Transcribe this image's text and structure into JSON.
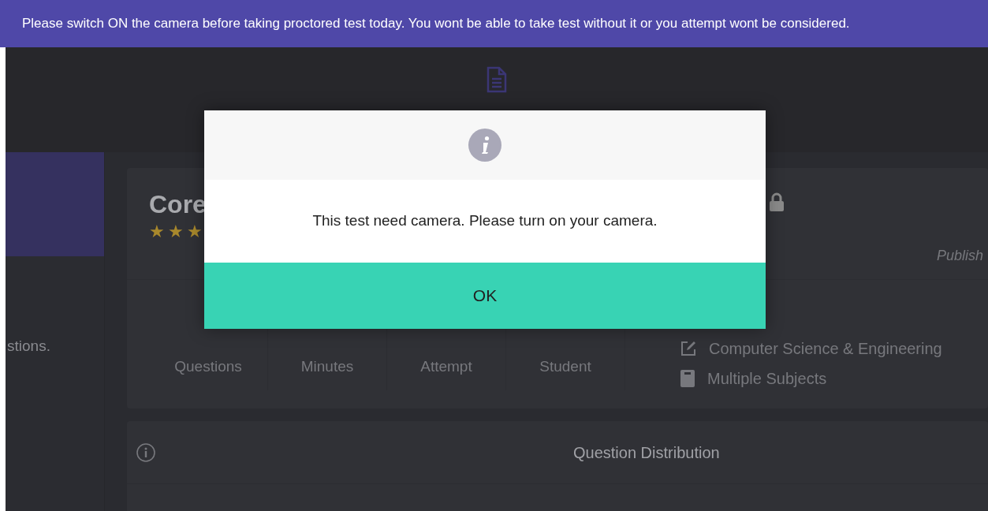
{
  "banner": {
    "text": "Please switch ON the camera before taking proctored test today. You wont be able to take test without it or you attempt wont be considered."
  },
  "sidebar": {
    "text": "stions."
  },
  "test_card": {
    "title": "Core",
    "stars": 3,
    "status": "Publish",
    "stats": [
      {
        "label": "Questions"
      },
      {
        "label": "Minutes"
      },
      {
        "label": "Attempt"
      },
      {
        "label": "Student"
      }
    ],
    "details": [
      {
        "kind": "edit",
        "text": "Computer Science & Engineering"
      },
      {
        "kind": "book",
        "text": "Multiple Subjects"
      }
    ]
  },
  "distribution": {
    "title": "Question Distribution"
  },
  "dialog": {
    "message": "This test need camera. Please turn on your camera.",
    "button": "OK"
  }
}
